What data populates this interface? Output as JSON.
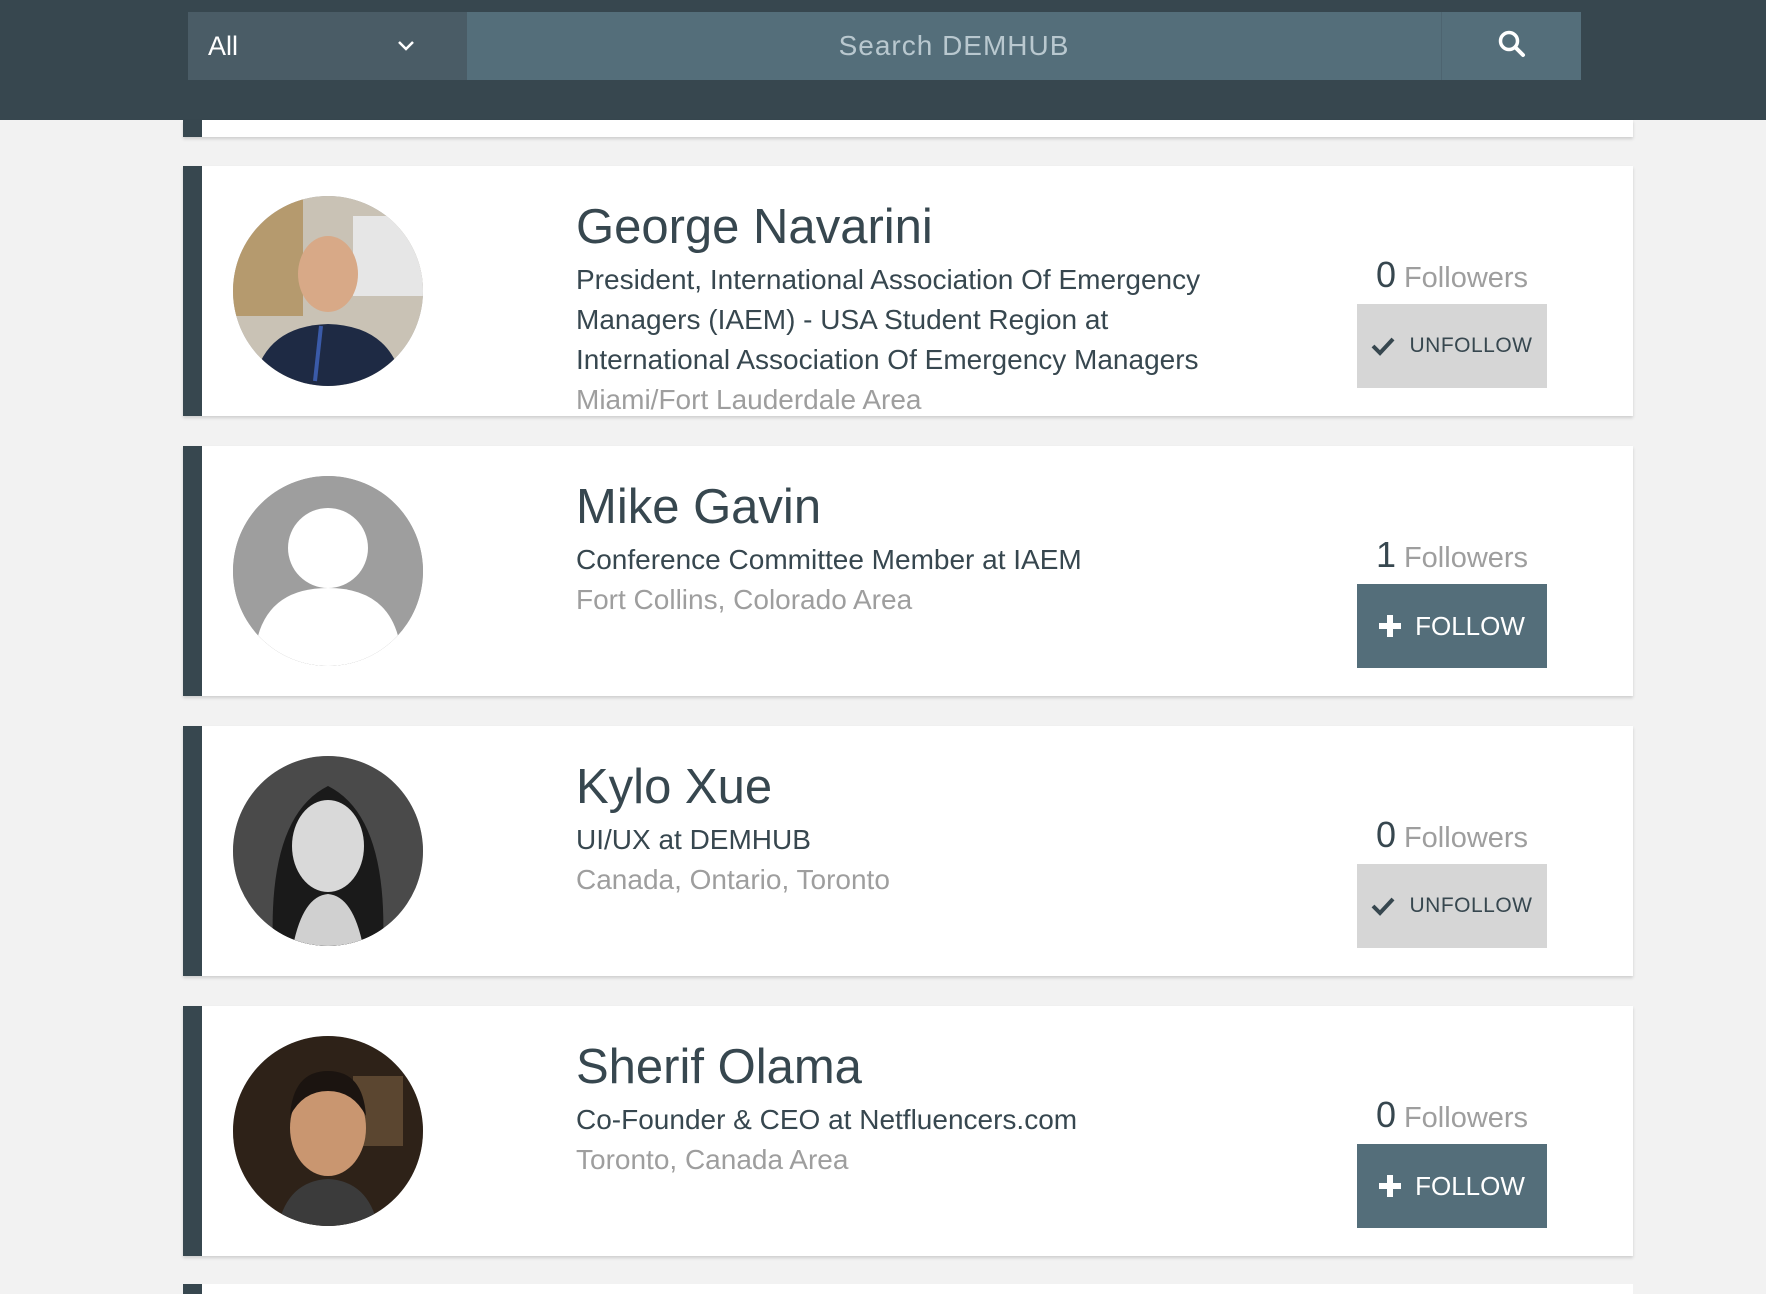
{
  "header": {
    "filter": {
      "selected": "All",
      "icon": "chevron-down-icon"
    },
    "search": {
      "placeholder": "Search DEMHUB",
      "icon": "search-icon"
    }
  },
  "colors": {
    "header_bg": "#37474f",
    "accent": "#546e7a",
    "unfollow_bg": "#d6d6d6",
    "muted_text": "#9e9e9e"
  },
  "people": [
    {
      "name": "George Navarini",
      "title": "President, International Association Of Emergency Managers (IAEM) - USA Student Region at International Association Of Emergency Managers",
      "location": "Miami/Fort Lauderdale Area",
      "followers_count": "0",
      "followers_label": "Followers",
      "button_label": "UNFOLLOW",
      "button_icon": "check-icon",
      "avatar": "photo"
    },
    {
      "name": "Mike Gavin",
      "title": "Conference Committee Member at IAEM",
      "location": "Fort Collins, Colorado Area",
      "followers_count": "1",
      "followers_label": "Followers",
      "button_label": "FOLLOW",
      "button_icon": "plus-icon",
      "avatar": "default-user-icon"
    },
    {
      "name": "Kylo Xue",
      "title": "UI/UX at DEMHUB",
      "location": "Canada, Ontario, Toronto",
      "followers_count": "0",
      "followers_label": "Followers",
      "button_label": "UNFOLLOW",
      "button_icon": "check-icon",
      "avatar": "photo"
    },
    {
      "name": "Sherif Olama",
      "title": "Co-Founder & CEO at Netfluencers.com",
      "location": "Toronto, Canada Area",
      "followers_count": "0",
      "followers_label": "Followers",
      "button_label": "FOLLOW",
      "button_icon": "plus-icon",
      "avatar": "photo"
    }
  ]
}
